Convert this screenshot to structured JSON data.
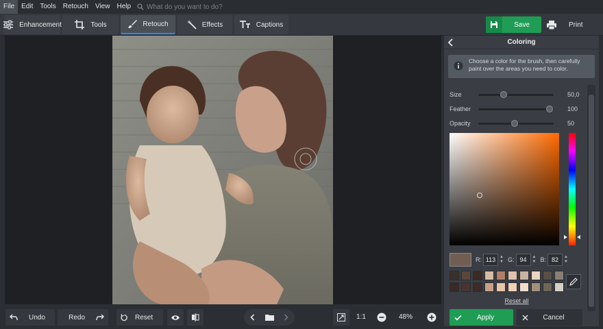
{
  "menu": {
    "items": [
      "File",
      "Edit",
      "Tools",
      "Retouch",
      "View",
      "Help"
    ],
    "search_placeholder": "What do you want to do?"
  },
  "tabs": [
    {
      "label": "Enhancement",
      "icon": "sliders-icon"
    },
    {
      "label": "Tools",
      "icon": "crop-icon"
    },
    {
      "label": "Retouch",
      "icon": "brush-icon",
      "active": true
    },
    {
      "label": "Effects",
      "icon": "magic-wand-icon"
    },
    {
      "label": "Captions",
      "icon": "text-icon"
    }
  ],
  "actions": {
    "save": "Save",
    "print": "Print"
  },
  "panel": {
    "title": "Coloring",
    "info": "Choose a color for the brush, then carefully paint over the areas you need to color.",
    "sliders": [
      {
        "label": "Size",
        "value": "50,0",
        "level": 0.38
      },
      {
        "label": "Feather",
        "value": "100",
        "level": 1.0
      },
      {
        "label": "Opacity",
        "value": "50",
        "level": 0.5
      }
    ],
    "color": {
      "r": "113",
      "g": "94",
      "b": "82",
      "hex": "#715e52"
    },
    "rgb_labels": {
      "r": "R:",
      "g": "G:",
      "b": "B:"
    },
    "palette": [
      "#3a302b",
      "#5a463c",
      "#3c2a26",
      "#d9b9a4",
      "#b08066",
      "#e0c2ae",
      "#c7b39e",
      "#e8d4c0",
      "#5a4e46",
      "#8a7e74",
      "#3a2a24",
      "#4a3430",
      "#3e2c28",
      "#c99f86",
      "#e8c4a8",
      "#f0d0b8",
      "#f2dccb",
      "#a0907c",
      "#706454",
      "#d4d0c4"
    ],
    "reset_all": "Reset all",
    "apply": "Apply",
    "cancel": "Cancel"
  },
  "bottom": {
    "undo": "Undo",
    "redo": "Redo",
    "reset": "Reset",
    "zoom_fit": "1:1",
    "zoom": "48%"
  }
}
